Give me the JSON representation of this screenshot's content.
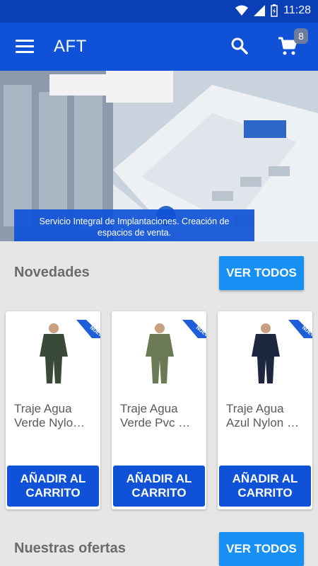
{
  "status": {
    "time": "11:28"
  },
  "appbar": {
    "title": "AFT",
    "cart_count": "8"
  },
  "banner": {
    "caption": "Servicio Integral de Implantaciones. Creación de espacios de venta."
  },
  "sections": [
    {
      "title": "Novedades",
      "button": "VER TODOS"
    },
    {
      "title": "Nuestras ofertas",
      "button": "VER TODOS"
    }
  ],
  "products": [
    {
      "name": "Traje Agua Verde Nylo…",
      "badge": "NUEVO",
      "button": "AÑADIR AL CARRITO",
      "color": "#3a4a38"
    },
    {
      "name": "Traje Agua Verde Pvc …",
      "badge": "NUEVO",
      "button": "AÑADIR AL CARRITO",
      "color": "#6b7a55"
    },
    {
      "name": "Traje Agua Azul Nylon …",
      "badge": "NUEVO",
      "button": "AÑADIR AL CARRITO",
      "color": "#1e2740"
    }
  ],
  "colors": {
    "primary": "#0f51d7",
    "statusbar": "#0a3fb8",
    "accent_button": "#1890f3"
  }
}
